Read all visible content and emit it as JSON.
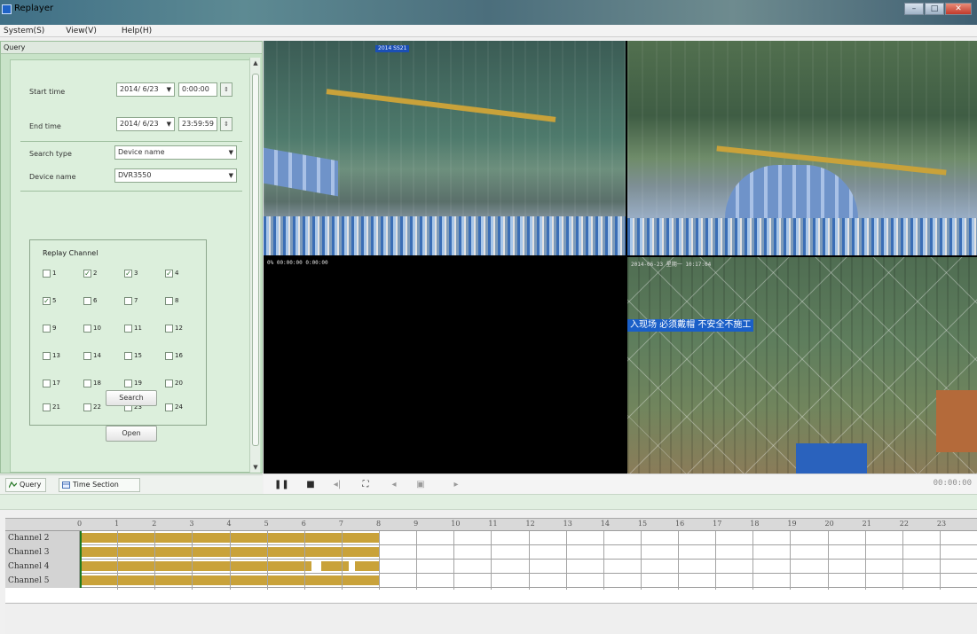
{
  "window": {
    "title": "Replayer"
  },
  "menu": [
    {
      "label": "System(S)"
    },
    {
      "label": "View(V)"
    },
    {
      "label": "Help(H)"
    }
  ],
  "panel": {
    "title": "Query",
    "start_time": {
      "label": "Start time",
      "date": "2014/ 6/23",
      "time": "0:00:00"
    },
    "end_time": {
      "label": "End time",
      "date": "2014/ 6/23",
      "time": "23:59:59"
    },
    "search_type": {
      "label": "Search type",
      "value": "Device name"
    },
    "device_name": {
      "label": "Device name",
      "value": "DVR3550"
    },
    "replay_channel": {
      "legend": "Replay Channel",
      "channels": [
        {
          "label": "1",
          "checked": false
        },
        {
          "label": "2",
          "checked": true
        },
        {
          "label": "3",
          "checked": true
        },
        {
          "label": "4",
          "checked": true
        },
        {
          "label": "5",
          "checked": true
        },
        {
          "label": "6",
          "checked": false
        },
        {
          "label": "7",
          "checked": false
        },
        {
          "label": "8",
          "checked": false
        },
        {
          "label": "9",
          "checked": false
        },
        {
          "label": "10",
          "checked": false
        },
        {
          "label": "11",
          "checked": false
        },
        {
          "label": "12",
          "checked": false
        },
        {
          "label": "13",
          "checked": false
        },
        {
          "label": "14",
          "checked": false
        },
        {
          "label": "15",
          "checked": false
        },
        {
          "label": "16",
          "checked": false
        },
        {
          "label": "17",
          "checked": false
        },
        {
          "label": "18",
          "checked": false
        },
        {
          "label": "19",
          "checked": false
        },
        {
          "label": "20",
          "checked": false
        },
        {
          "label": "21",
          "checked": false
        },
        {
          "label": "22",
          "checked": false
        },
        {
          "label": "23",
          "checked": false
        },
        {
          "label": "24",
          "checked": false
        }
      ]
    },
    "search_button": "Search",
    "open_button": "Open",
    "tabs": [
      {
        "label": "Query"
      },
      {
        "label": "Time Section"
      }
    ]
  },
  "video": {
    "views": [
      {
        "name": "cam-1",
        "timestamp": "",
        "banners": [
          "2014 SS21"
        ]
      },
      {
        "name": "cam-2",
        "timestamp": "",
        "banners": []
      },
      {
        "name": "cam-3",
        "timestamp": "0% 00:00:00 0:00:00",
        "banners": []
      },
      {
        "name": "cam-4",
        "timestamp": "2014-06-23 星期一 10:17:04",
        "banners": [
          "入现场 必须戴帽 不安全不施工"
        ]
      }
    ],
    "timecode": "00:00:00"
  },
  "timeline": {
    "hours": [
      "0",
      "1",
      "2",
      "3",
      "4",
      "5",
      "6",
      "7",
      "8",
      "9",
      "10",
      "11",
      "12",
      "13",
      "14",
      "15",
      "16",
      "17",
      "18",
      "19",
      "20",
      "21",
      "22",
      "23"
    ],
    "channels": [
      {
        "label": "Channel 2",
        "segments": [
          [
            0,
            8.0
          ]
        ]
      },
      {
        "label": "Channel 3",
        "segments": [
          [
            0,
            8.0
          ]
        ]
      },
      {
        "label": "Channel 4",
        "segments": [
          [
            0,
            6.2
          ],
          [
            6.4,
            7.2
          ],
          [
            7.3,
            8.0
          ]
        ]
      },
      {
        "label": "Channel 5",
        "segments": [
          [
            0,
            8.0
          ]
        ]
      }
    ],
    "record_color": "#c9a23a",
    "playhead_hour": 0
  },
  "colors": {
    "panel_bg": "#c8e3c8",
    "accent": "#1a5fc8"
  }
}
